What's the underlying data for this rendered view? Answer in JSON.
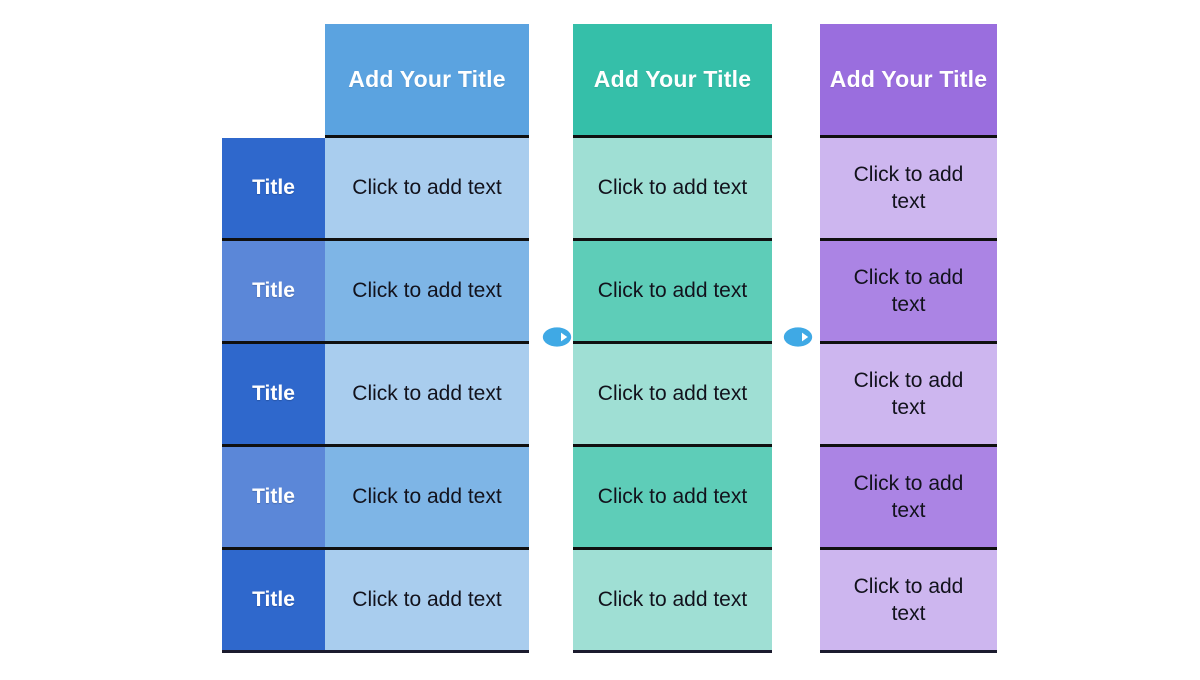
{
  "slide": {
    "background": "#ffffff",
    "divider_color": "#101010"
  },
  "columns": [
    {
      "id": "blue",
      "name": "blue-column",
      "header": "Add Your Title",
      "header_color": "#5ba3e0",
      "has_label_column": true,
      "label_colors": [
        "#2f68cc",
        "#5b87d8",
        "#2f68cc",
        "#5b87d8",
        "#2f68cc"
      ],
      "body_colors": [
        "#a9cdee",
        "#7eb5e6",
        "#a9cdee",
        "#7eb5e6",
        "#a9cdee"
      ],
      "rows": [
        {
          "label": "Title",
          "text": "Click to add text"
        },
        {
          "label": "Title",
          "text": "Click to add text"
        },
        {
          "label": "Title",
          "text": "Click to add text"
        },
        {
          "label": "Title",
          "text": "Click to add text"
        },
        {
          "label": "Title",
          "text": "Click to add text"
        }
      ]
    },
    {
      "id": "teal",
      "name": "teal-column",
      "header": "Add Your Title",
      "header_color": "#35bfa9",
      "has_label_column": false,
      "label_colors": [],
      "body_colors": [
        "#9fdfd4",
        "#5ecdb8",
        "#9fdfd4",
        "#5ecdb8",
        "#9fdfd4"
      ],
      "rows": [
        {
          "label": "",
          "text": "Click to add text"
        },
        {
          "label": "",
          "text": "Click to add text"
        },
        {
          "label": "",
          "text": "Click to add text"
        },
        {
          "label": "",
          "text": "Click to add text"
        },
        {
          "label": "",
          "text": "Click to add text"
        }
      ]
    },
    {
      "id": "purple",
      "name": "purple-column",
      "header": "Add Your Title",
      "header_color": "#9a6ede",
      "has_label_column": false,
      "label_colors": [],
      "body_colors": [
        "#cdb6ef",
        "#ab84e4",
        "#cdb6ef",
        "#ab84e4",
        "#cdb6ef"
      ],
      "rows": [
        {
          "label": "",
          "text": "Click to add text"
        },
        {
          "label": "",
          "text": "Click to add text"
        },
        {
          "label": "",
          "text": "Click to add text"
        },
        {
          "label": "",
          "text": "Click to add text"
        },
        {
          "label": "",
          "text": "Click to add text"
        }
      ]
    }
  ],
  "connectors": [
    {
      "name": "arrow-right-icon",
      "icon": "arrow-right-circle-icon",
      "fill": "#3fa9e5",
      "arrow_fill": "#ffffff"
    },
    {
      "name": "arrow-right-icon",
      "icon": "arrow-right-circle-icon",
      "fill": "#3fa9e5",
      "arrow_fill": "#ffffff"
    }
  ]
}
